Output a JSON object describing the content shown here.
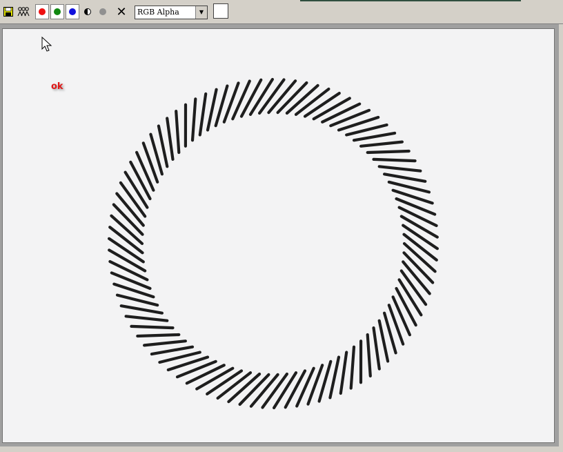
{
  "toolbar": {
    "save_icon": "floppy-disk-icon",
    "people_icon": "people-icon",
    "channels": [
      {
        "name": "red",
        "color": "#ee1111"
      },
      {
        "name": "green",
        "color": "#118811"
      },
      {
        "name": "blue",
        "color": "#1111dd"
      }
    ],
    "contrast_icon": "half-circle-icon",
    "gray_color": "#909090",
    "close_glyph": "✕",
    "mode_select": {
      "value": "RGB Alpha"
    },
    "swatch_color": "#ffffff"
  },
  "canvas": {
    "status_text": "ok",
    "status_color": "#e01818",
    "ring": {
      "stroke_count": 90,
      "stroke_color": "#1e1e1e"
    }
  }
}
